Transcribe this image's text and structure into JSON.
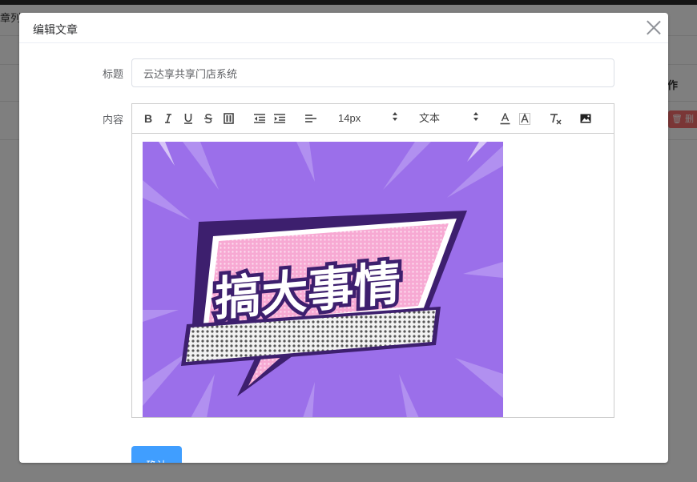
{
  "background": {
    "title": "章列",
    "operation_header": "操作",
    "delete_label": "删除"
  },
  "dialog": {
    "title": "编辑文章",
    "title_label": "标题",
    "title_value": "云达享共享门店系统",
    "content_label": "内容",
    "confirm_label": "确认"
  },
  "toolbar": {
    "font_size": "14px",
    "block_format": "文本",
    "buttons": [
      "bold-icon",
      "italic-icon",
      "underline-icon",
      "strikethrough-icon",
      "code-block-icon",
      "indent-decrease-icon",
      "indent-increase-icon",
      "align-icon",
      "font-color-icon",
      "background-color-icon",
      "clear-format-icon",
      "image-icon"
    ]
  },
  "poster": {
    "headline": "搞大事情",
    "colors": {
      "background": "#9b6fea",
      "banner": "#f7a9d3",
      "outline": "#3d1f6e",
      "ribbon": "#f2f2f2"
    }
  }
}
